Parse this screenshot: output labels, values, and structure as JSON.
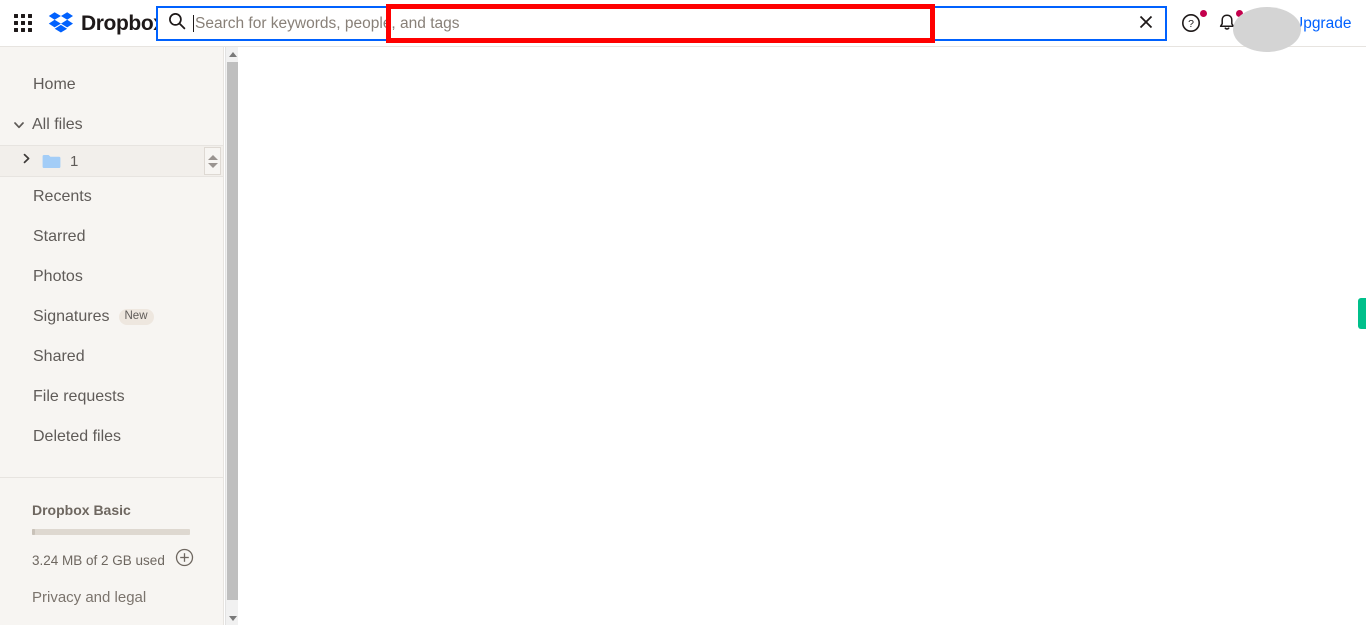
{
  "header": {
    "app_grid_icon": "apps-grid-icon",
    "brand": "Dropbox",
    "logo_icon": "dropbox-logo-icon",
    "logo_color": "#0061fe",
    "search": {
      "icon": "search-icon",
      "value": "",
      "placeholder": "Search for keywords, people, and tags",
      "clear_icon": "close-icon",
      "focus_border_color": "#0061fe"
    },
    "help_icon": "help-circle-icon",
    "help_badge": true,
    "notifications_icon": "bell-icon",
    "notifications_badge": true,
    "notification_dot_color": "#c3004c",
    "avatar": "avatar",
    "upgrade_label": "Upgrade",
    "upgrade_color": "#0061ff"
  },
  "annotation": {
    "highlight_color": "#ff0000",
    "target": "search-input"
  },
  "sidebar": {
    "items": [
      {
        "label": "Home",
        "name": "sidebar-item-home"
      },
      {
        "label": "All files",
        "name": "sidebar-item-all-files",
        "chevron": "chevron-down-icon",
        "expanded": true
      },
      {
        "label": "Recents",
        "name": "sidebar-item-recents"
      },
      {
        "label": "Starred",
        "name": "sidebar-item-starred"
      },
      {
        "label": "Photos",
        "name": "sidebar-item-photos"
      },
      {
        "label": "Signatures",
        "name": "sidebar-item-signatures",
        "badge": "New"
      },
      {
        "label": "Shared",
        "name": "sidebar-item-shared"
      },
      {
        "label": "File requests",
        "name": "sidebar-item-file-requests"
      },
      {
        "label": "Deleted files",
        "name": "sidebar-item-deleted-files"
      }
    ],
    "folder": {
      "name": "1",
      "chevron": "chevron-right-icon",
      "folder_icon": "folder-icon",
      "folder_color": "#a3cdf7"
    },
    "plan": {
      "name": "Dropbox Basic",
      "storage_text": "3.24 MB of 2 GB used",
      "used_percent": 0.16,
      "add_icon": "plus-circle-icon"
    },
    "privacy_label": "Privacy and legal",
    "scrollbar": {
      "up_icon": "scroll-up-arrow-icon",
      "down_icon": "scroll-down-arrow-icon"
    }
  },
  "main": {
    "content": "",
    "side_tab_color": "#00c08b",
    "side_tab_name": "feedback-tab"
  }
}
